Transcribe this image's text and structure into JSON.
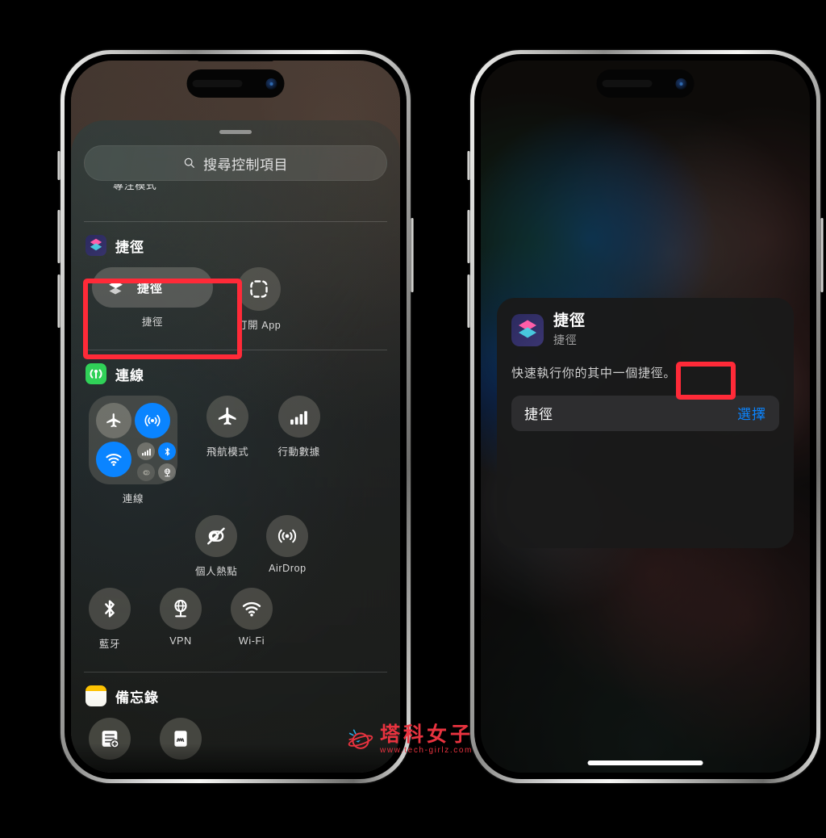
{
  "left_phone": {
    "control_center": {
      "search": {
        "placeholder": "搜尋控制項目",
        "icon": "search-icon"
      },
      "focus_label": "專注模式",
      "sections": [
        {
          "id": "shortcuts",
          "app_icon": "shortcuts-app-icon",
          "label": "捷徑",
          "items": [
            {
              "type": "pill",
              "icon": "shortcuts-layers-icon",
              "inline_label": "捷徑",
              "caption": "捷徑",
              "highlighted": true
            },
            {
              "type": "circle",
              "icon": "open-app-dashed-square-icon",
              "caption": "打開 App",
              "highlighted": false
            }
          ]
        },
        {
          "id": "connectivity",
          "app_icon": "connectivity-icon",
          "label": "連線",
          "items": [
            {
              "type": "combo",
              "caption": "連線",
              "toggles": [
                {
                  "name": "airplane-mode-toggle",
                  "state": "off"
                },
                {
                  "name": "airdrop-toggle",
                  "state": "on"
                },
                {
                  "name": "wifi-toggle",
                  "state": "on"
                },
                {
                  "name": "cellular-toggle",
                  "state": "off"
                },
                {
                  "name": "bluetooth-toggle",
                  "state": "on"
                },
                {
                  "name": "hotspot-toggle",
                  "state": "off"
                },
                {
                  "name": "vpn-toggle",
                  "state": "off"
                }
              ]
            },
            {
              "type": "circle",
              "icon": "airplane-icon",
              "caption": "飛航模式"
            },
            {
              "type": "circle",
              "icon": "cellular-bars-icon",
              "caption": "行動數據"
            },
            {
              "type": "circle",
              "icon": "hotspot-off-icon",
              "caption": "個人熱點"
            },
            {
              "type": "circle",
              "icon": "airdrop-icon",
              "caption": "AirDrop"
            },
            {
              "type": "circle",
              "icon": "bluetooth-icon",
              "caption": "藍牙"
            },
            {
              "type": "circle",
              "icon": "vpn-globe-icon",
              "caption": "VPN"
            },
            {
              "type": "circle",
              "icon": "wifi-icon",
              "caption": "Wi-Fi"
            }
          ]
        },
        {
          "id": "notes",
          "app_icon": "notes-app-icon",
          "label": "備忘錄",
          "items": [
            {
              "type": "circle",
              "icon": "new-note-icon",
              "caption": ""
            },
            {
              "type": "circle",
              "icon": "quick-note-icon",
              "caption": ""
            }
          ]
        }
      ]
    }
  },
  "right_phone": {
    "dialog": {
      "app_icon": "shortcuts-app-icon",
      "title": "捷徑",
      "subtitle": "捷徑",
      "description": "快速執行你的其中一個捷徑。",
      "field": {
        "label": "捷徑",
        "action": "選擇",
        "action_highlighted": true
      }
    }
  },
  "watermark": {
    "logo": "planet-logo-icon",
    "name": "塔科女子",
    "url": "www.tech-girlz.com"
  },
  "colors": {
    "accent_blue": "#0a84ff",
    "highlight_red": "#ff2a38",
    "green": "#30d158",
    "notes_yellow": "#fdc202"
  }
}
